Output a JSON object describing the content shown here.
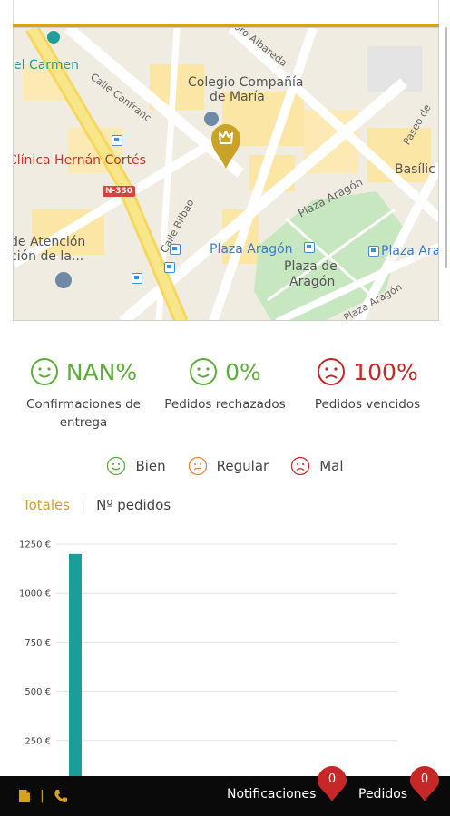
{
  "map": {
    "labels": {
      "el_carmen": "el Carmen",
      "calle_canfranc": "Calle Canfranc",
      "albareda": "Isidoro Albareda",
      "colegio": "Colegio Compañía",
      "colegio2": "de María",
      "clinica": "Clínica Hernán Cortés",
      "basilic": "Basílic",
      "paseo": "Paseo de",
      "n330": "N-330",
      "calle_bilbao": "Calle Bilbao",
      "plaza_aragon_street": "Plaza Aragón",
      "plaza_aragon_stop": "Plaza Aragón",
      "plaza_aragon_stop2": "Plaza Ara",
      "plaza_de": "Plaza de",
      "aragon": "Aragón",
      "atencion": "de Atención",
      "atencion2": "ción de la...",
      "plaza_aragon_bottom": "Plaza Aragón"
    }
  },
  "stats": [
    {
      "value": "NAN%",
      "label_line1": "Confirmaciones de",
      "label_line2": "entrega",
      "color": "#5cad3a",
      "face": "happy-face-icon"
    },
    {
      "value": "0%",
      "label_line1": "Pedidos rechazados",
      "label_line2": "",
      "color": "#5cad3a",
      "face": "happy-face-icon"
    },
    {
      "value": "100%",
      "label_line1": "Pedidos vencidos",
      "label_line2": "",
      "color": "#c62828",
      "face": "sad-face-icon"
    }
  ],
  "legend": [
    {
      "label": "Bien",
      "color": "#5cad3a"
    },
    {
      "label": "Regular",
      "color": "#e8833a"
    },
    {
      "label": "Mal",
      "color": "#c62828"
    }
  ],
  "tabs": {
    "active": "Totales",
    "other": "Nº pedidos"
  },
  "chart_data": {
    "type": "bar",
    "categories": [
      ""
    ],
    "values": [
      1200
    ],
    "yticks": [
      "1250 €",
      "1000 €",
      "750 €",
      "500 €",
      "250 €"
    ],
    "ytick_values": [
      1250,
      1000,
      750,
      500,
      250
    ],
    "ylim": [
      0,
      1250
    ],
    "bar_color": "#1a9e9a",
    "grid": true
  },
  "bottom_bar": {
    "notificaciones": "Notificaciones",
    "notif_count": "0",
    "pedidos": "Pedidos",
    "pedidos_count": "0",
    "accent": "#d4a21d",
    "pin_color": "#c62828"
  }
}
